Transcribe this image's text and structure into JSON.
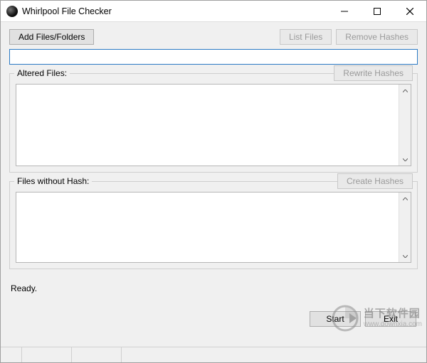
{
  "window": {
    "title": "Whirlpool File Checker"
  },
  "toolbar": {
    "add_label": "Add Files/Folders",
    "list_label": "List Files",
    "remove_label": "Remove Hashes"
  },
  "path_input": {
    "value": "",
    "placeholder": ""
  },
  "groups": {
    "altered": {
      "label": "Altered Files:",
      "button_label": "Rewrite Hashes",
      "content": ""
    },
    "nohash": {
      "label": "Files without Hash:",
      "button_label": "Create Hashes",
      "content": ""
    }
  },
  "status": "Ready.",
  "bottom": {
    "start_label": "Start",
    "exit_label": "Exit"
  },
  "watermark": {
    "text": "当下软件园",
    "url": "www.downxia.com"
  }
}
